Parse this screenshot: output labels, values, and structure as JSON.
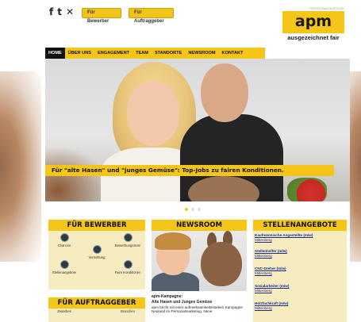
{
  "top_buttons": {
    "bewerber": "Für Bewerber",
    "auftraggeber": "Für Auftraggeber"
  },
  "logo": {
    "tagline_top": "PERSONALSERVICE",
    "text": "apm",
    "tagline": "ausgezeichnet fair"
  },
  "nav": {
    "items": [
      "HOME",
      "ÜBER UNS",
      "ENGAGEMENT",
      "TEAM",
      "STANDORTE",
      "NEWSROOM",
      "KONTAKT"
    ],
    "active_index": 0
  },
  "hero": {
    "caption": "Für \"alte Hasen\" und \"junges Gemüse\": Top-Jobs zu fairen Konditionen.",
    "slides": 3,
    "active_slide": 0
  },
  "bewerber": {
    "title": "FÜR BEWERBER",
    "items": [
      "Chancen",
      "Vermittlung",
      "Bewerbungsziele",
      "Stellenangebote",
      "Faire Konditionen"
    ]
  },
  "auftraggeber": {
    "title": "FÜR AUFTRAGGEBER",
    "items": [
      "Zeitarbeit",
      "Branchen"
    ]
  },
  "newsroom": {
    "title": "NEWSROOM",
    "headline_1": "apm-Kampagne:",
    "headline_2": "Alte Hasen und Junges Gemüse",
    "body": "apm bricht mit einer aufmerksamkeitsstarken Kampagne Neuland im Personalmarketing. Neue"
  },
  "jobs": {
    "title": "STELLENANGEBOTE",
    "items": [
      {
        "title": "Kaufmännische Angestellte (m/w)",
        "location": "Mittenberg"
      },
      {
        "title": "Stellenhelfer (m/w)",
        "location": "Mittenberg"
      },
      {
        "title": "CNC-Dreher (m/w)",
        "location": "Mittenberg"
      },
      {
        "title": "Sozialarbeiter (m/w)",
        "location": "Mittenberg"
      },
      {
        "title": "Holzfachkraft (m/w)",
        "location": "Mittenberg"
      }
    ]
  },
  "colors": {
    "brand_yellow": "#f5c518",
    "panel": "#f7ecc0",
    "nav_active": "#111111",
    "link": "#1c2e8c"
  },
  "icons": {
    "social": [
      "facebook-icon",
      "tumblr-icon",
      "xing-icon"
    ]
  }
}
